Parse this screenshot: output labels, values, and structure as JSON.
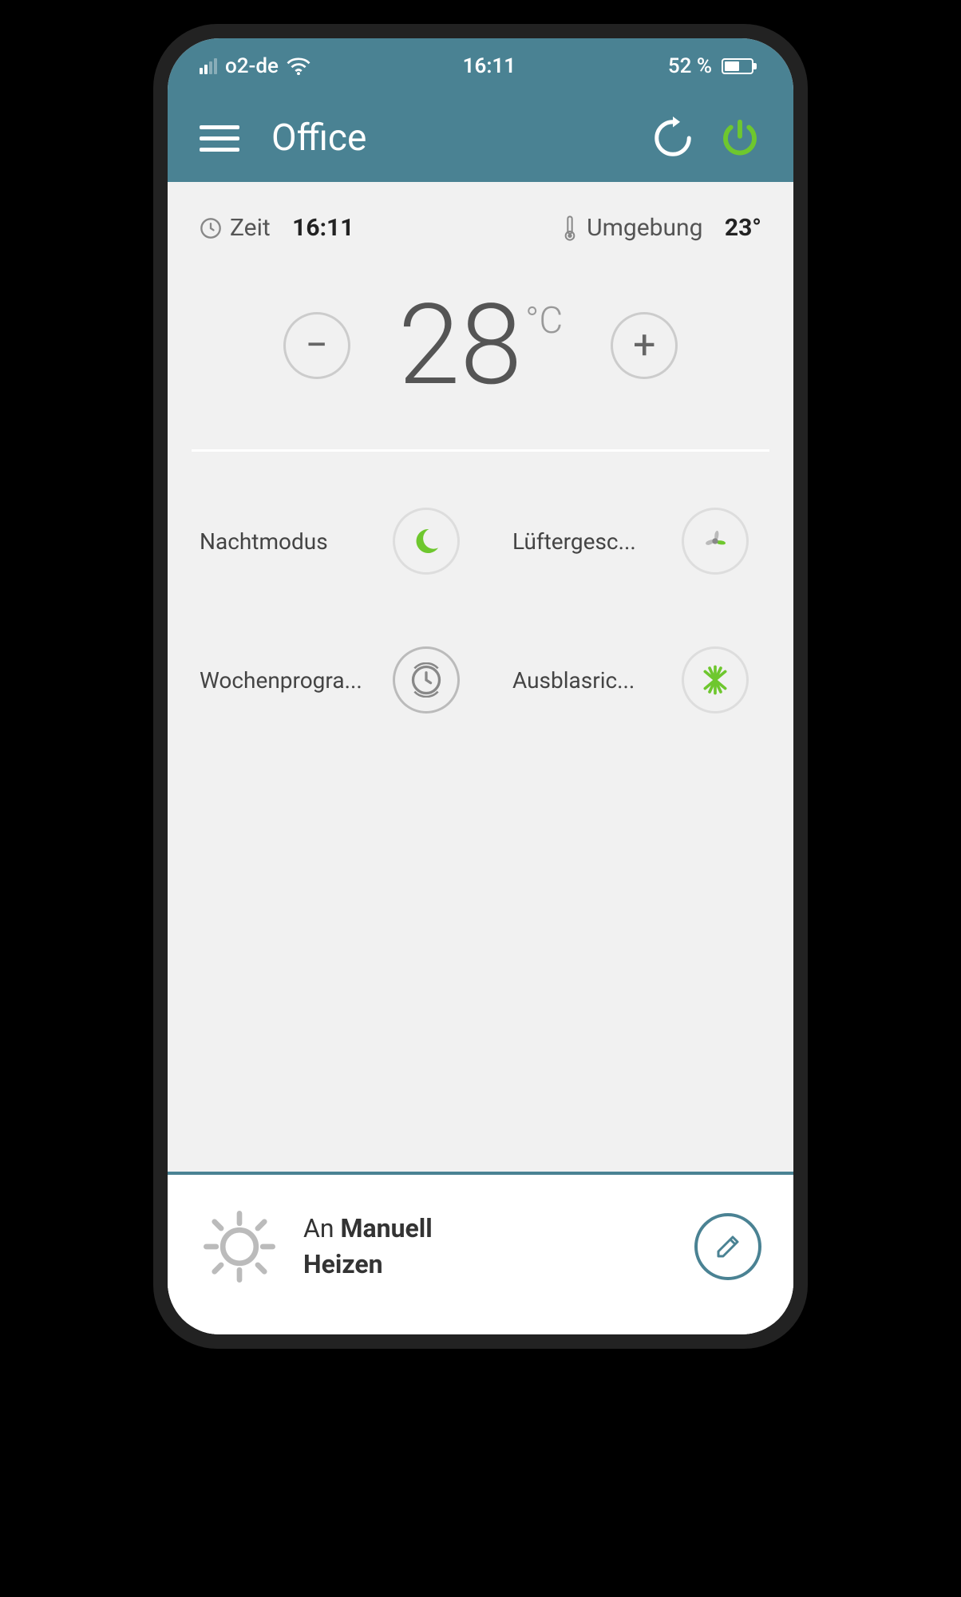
{
  "status": {
    "carrier": "o2-de",
    "time": "16:11",
    "battery_pct": "52 %"
  },
  "header": {
    "title": "Office"
  },
  "info": {
    "time_label": "Zeit",
    "time_value": "16:11",
    "ambient_label": "Umgebung",
    "ambient_value": "23°"
  },
  "temperature": {
    "setpoint": "28",
    "unit": "°C"
  },
  "controls": {
    "night_label": "Nachtmodus",
    "fan_label": "Lüftergesc...",
    "schedule_label": "Wochenprogra...",
    "airflow_label": "Ausblasric..."
  },
  "footer": {
    "status_prefix": "An",
    "mode": "Manuell",
    "operation": "Heizen"
  },
  "colors": {
    "accent": "#4a8293",
    "active": "#6ec72e"
  }
}
